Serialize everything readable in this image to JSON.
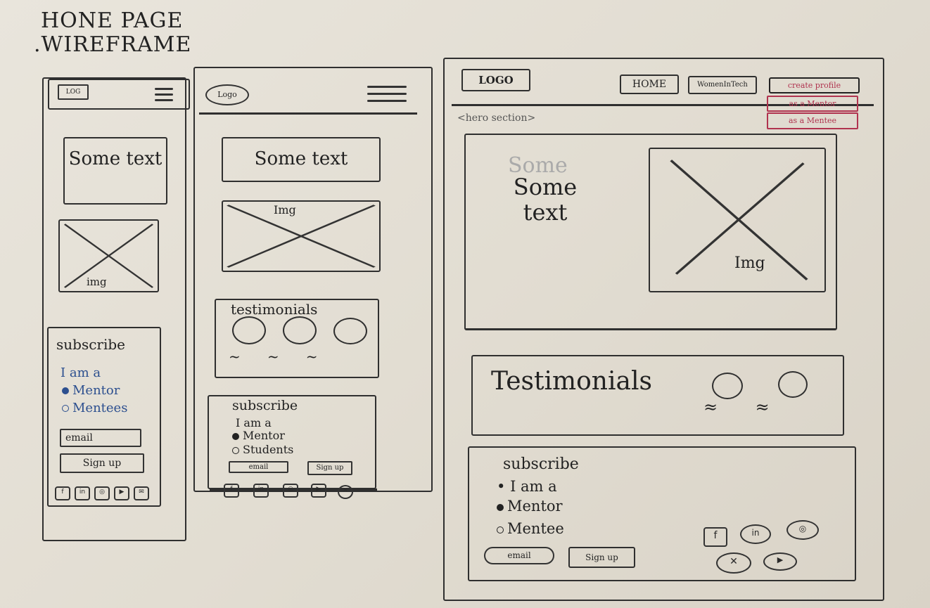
{
  "title": {
    "line1": "HONE PAGE",
    "line2": ".WIREFRAME"
  },
  "mobile": {
    "logo": "LOG",
    "hero_text": "Some text",
    "img_label": "img",
    "subscribe": {
      "heading": "subscribe",
      "prompt": "I am a",
      "options": [
        "Mentor",
        "Mentees"
      ],
      "email": "email",
      "signup": "Sign up"
    },
    "icons": [
      "facebook-icon",
      "linkedin-icon",
      "instagram-icon",
      "youtube-icon",
      "twitter-icon"
    ]
  },
  "tablet": {
    "logo": "Logo",
    "hero_text": "Some text",
    "img_label": "Img",
    "testimonials": "testimonials",
    "subscribe": {
      "heading": "subscribe",
      "prompt": "I am a",
      "options": [
        "Mentor",
        "Students"
      ],
      "email": "email",
      "signup": "Sign up"
    }
  },
  "desktop": {
    "logo": "LOGO",
    "nav": [
      "HOME",
      "WomenInTech",
      "create profile"
    ],
    "dropdown": [
      "as a Mentor",
      "as a Mentee"
    ],
    "hero_label": "<hero section>",
    "hero_text_faint": "Some",
    "hero_text": "Some text",
    "img_label": "Img",
    "testimonials": "Testimonials",
    "subscribe": {
      "heading": "subscribe",
      "prompt": "I am a",
      "options": [
        "Mentor",
        "Mentee"
      ],
      "email": "email",
      "signup": "Sign up"
    }
  },
  "colors": {
    "ink": "#2f2f2f",
    "red": "#b0334f",
    "blue": "#2c4f8f"
  }
}
